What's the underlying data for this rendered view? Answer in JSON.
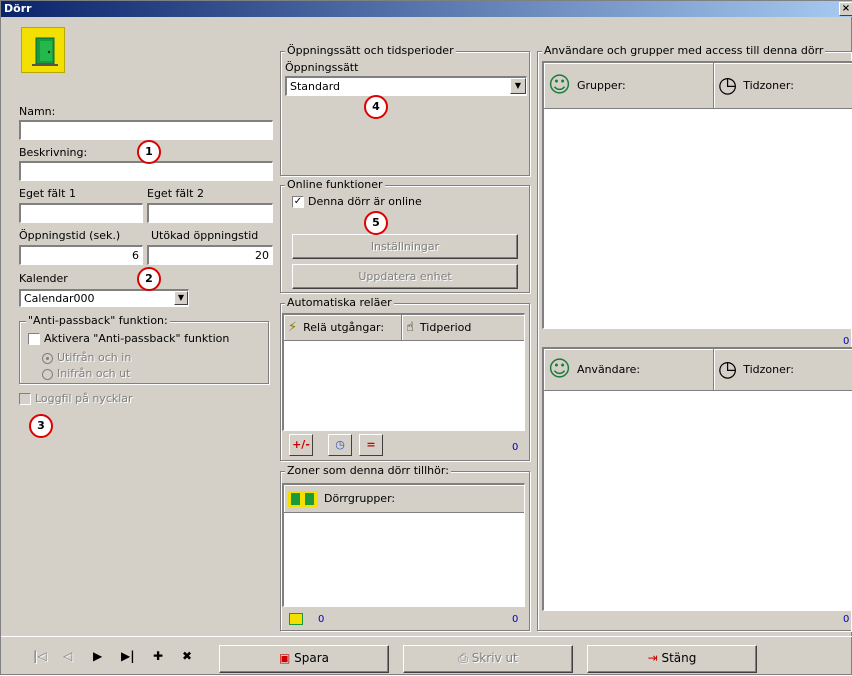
{
  "window": {
    "title": "Dörr",
    "close_glyph": "×"
  },
  "door": {
    "icon": "door-icon",
    "name_label": "Namn:",
    "name_value": "",
    "description_label": "Beskrivning:",
    "description_value": "",
    "custom1_label": "Eget fält 1",
    "custom1_value": "",
    "custom2_label": "Eget fält 2",
    "custom2_value": "",
    "open_time_label": "Öppningstid (sek.)",
    "open_time_value": "6",
    "ext_open_time_label": "Utökad öppningstid",
    "ext_open_time_value": "20",
    "calendar_label": "Kalender",
    "calendar_value": "Calendar000"
  },
  "antipassback": {
    "group_title": "\"Anti-passback\" funktion:",
    "enable_label": "Aktivera \"Anti-passback\" funktion",
    "option_out_in": "Utifrån och in",
    "option_in_out": "Inifrån och ut"
  },
  "logfile_label": "Loggfil på nycklar",
  "opening": {
    "group_title": "Öppningssätt och tidsperioder",
    "mode_label": "Öppningssätt",
    "mode_value": "Standard"
  },
  "online": {
    "group_title": "Online funktioner",
    "online_label": "Denna dörr är online",
    "settings_button": "Inställningar",
    "update_button": "Uppdatera enhet"
  },
  "relays": {
    "group_title": "Automatiska reläer",
    "col_outputs": "Relä utgångar:",
    "col_timeperiod": "Tidperiod",
    "tool_plusminus": "+/-",
    "tool_equals": "=",
    "count": "0"
  },
  "zones": {
    "group_title": "Zoner som denna dörr tillhör:",
    "col_doorgroups": "Dörrgrupper:",
    "count_left": "0",
    "count_right": "0"
  },
  "access": {
    "group_title": "Användare och grupper med access till denna dörr",
    "groups_col": "Grupper:",
    "timezones_col": "Tidzoner:",
    "groups_count": "0",
    "users_col": "Användare:",
    "users_timezones_col": "Tidzoner:",
    "users_count": "0"
  },
  "markers": [
    "1",
    "2",
    "3",
    "4",
    "5"
  ],
  "footer": {
    "nav_first": "|◁",
    "nav_prev": "◁",
    "nav_next": "▶",
    "nav_last": "▶|",
    "nav_add": "✚",
    "nav_delete": "✖",
    "save_button": "Spara",
    "print_button": "Skriv ut",
    "close_button": "Stäng"
  },
  "colors": {
    "face": "#d4d0c8",
    "title_start": "#0a246a",
    "marker_ring": "#dd0000",
    "count_text": "#0000c0"
  }
}
